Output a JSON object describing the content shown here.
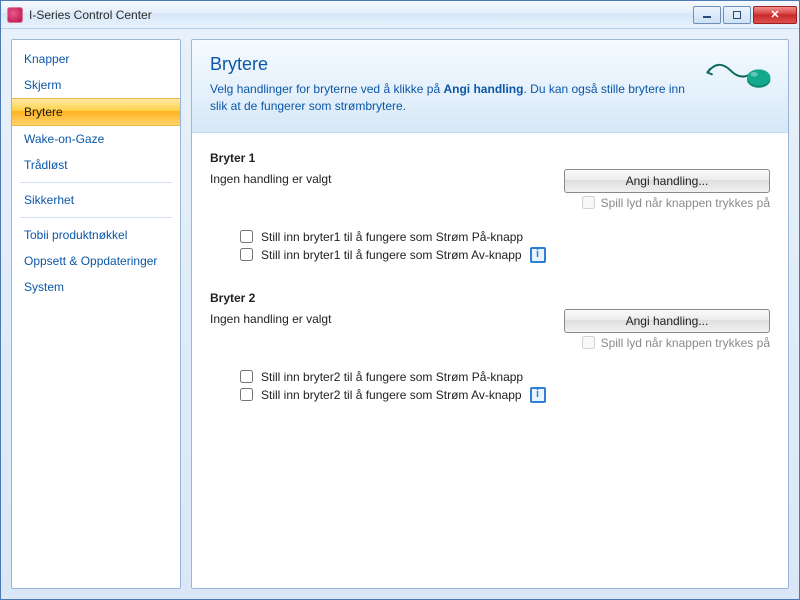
{
  "window": {
    "title": "I-Series Control Center"
  },
  "sidebar": {
    "items": [
      {
        "label": "Knapper",
        "selected": false
      },
      {
        "label": "Skjerm",
        "selected": false
      },
      {
        "label": "Brytere",
        "selected": true
      },
      {
        "label": "Wake-on-Gaze",
        "selected": false
      },
      {
        "label": "Trådløst",
        "selected": false
      }
    ],
    "group2": [
      {
        "label": "Sikkerhet"
      }
    ],
    "group3": [
      {
        "label": "Tobii produktnøkkel"
      },
      {
        "label": "Oppsett & Oppdateringer"
      },
      {
        "label": "System"
      }
    ]
  },
  "header": {
    "title": "Brytere",
    "desc_pre": "Velg handlinger for bryterne ved å klikke på ",
    "desc_bold": "Angi handling",
    "desc_post": ". Du kan også stille brytere inn slik at de fungerer som strømbrytere."
  },
  "switches": [
    {
      "title": "Bryter 1",
      "status": "Ingen handling er valgt",
      "action_btn": "Angi handling...",
      "play_sound_label": "Spill lyd når knappen trykkes på",
      "opt_on": "Still inn bryter1 til å fungere som Strøm På-knapp",
      "opt_off": "Still inn bryter1 til å fungere som Strøm Av-knapp"
    },
    {
      "title": "Bryter 2",
      "status": "Ingen handling er valgt",
      "action_btn": "Angi handling...",
      "play_sound_label": "Spill lyd når knappen trykkes på",
      "opt_on": "Still inn bryter2 til å fungere som Strøm På-knapp",
      "opt_off": "Still inn bryter2 til å fungere som Strøm Av-knapp"
    }
  ]
}
